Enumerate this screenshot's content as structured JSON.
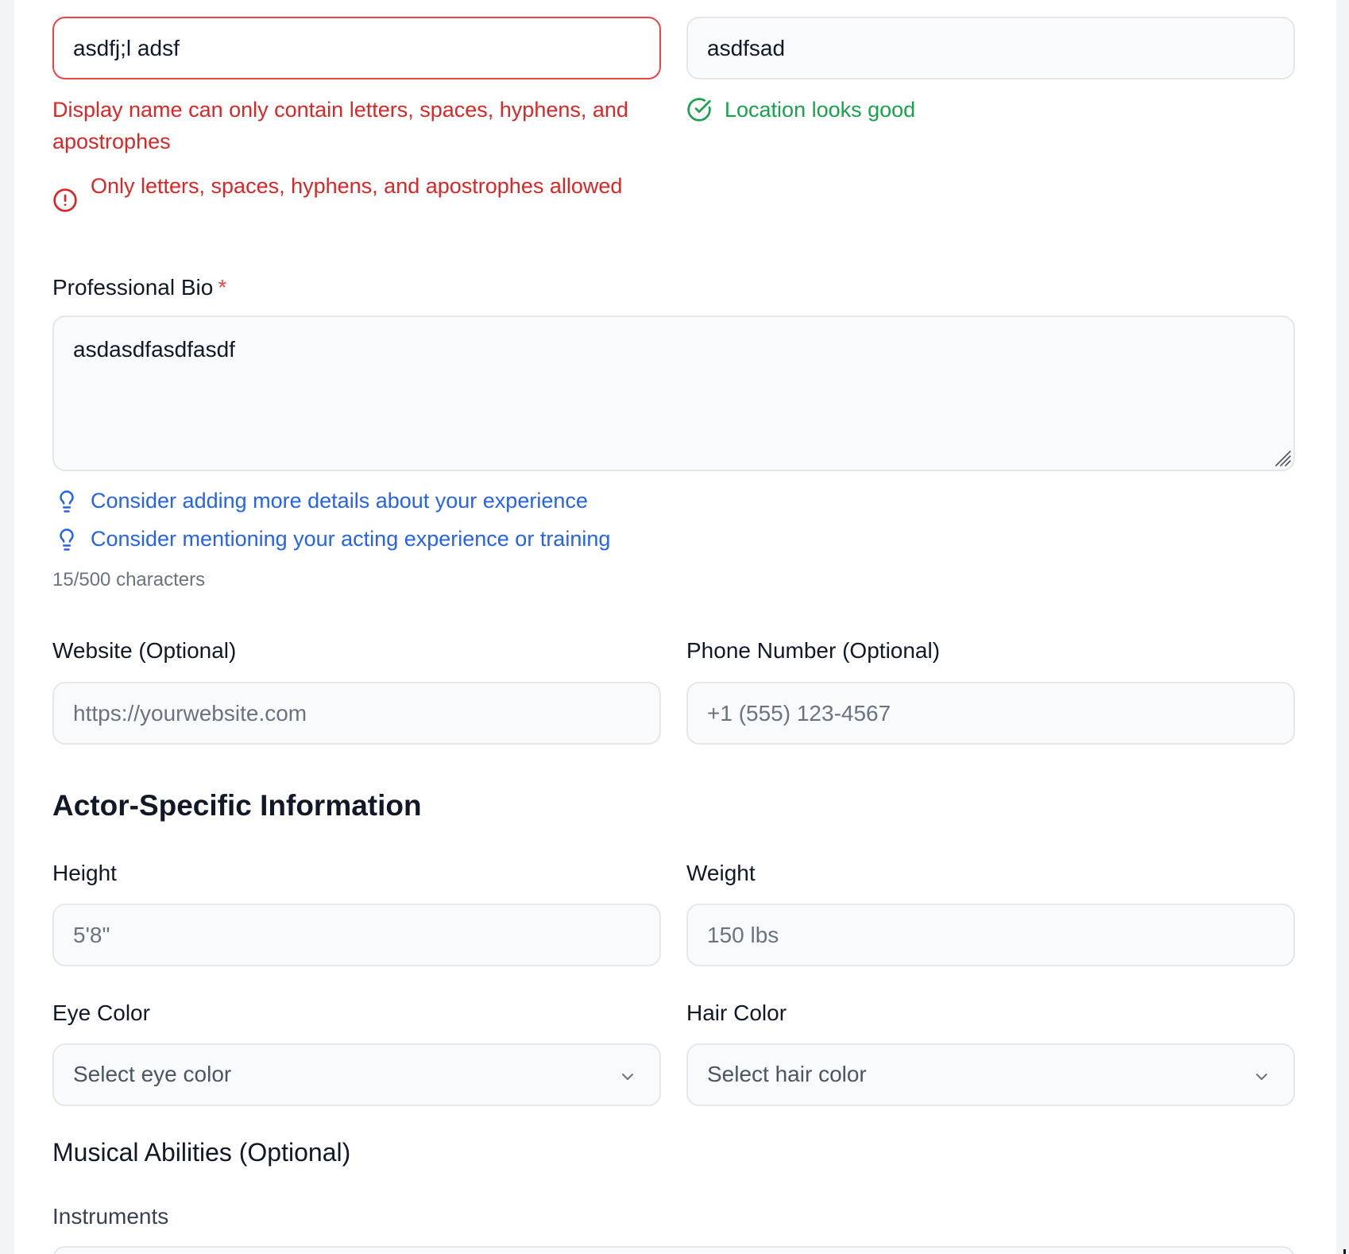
{
  "colors": {
    "error": "#dc2626",
    "success": "#16a34a",
    "hint": "#2563eb",
    "required": "#ef4444"
  },
  "display_name": {
    "value": "asdfj;l adsf",
    "error_message": "Display name can only contain letters, spaces, hyphens, and apostrophes",
    "validation_message": "Only letters, spaces, hyphens, and apostrophes allowed",
    "icon": "alert-circle-icon"
  },
  "location": {
    "value": "asdfsad",
    "success_message": "Location looks good",
    "icon": "check-circle-icon"
  },
  "bio": {
    "label": "Professional Bio",
    "required_mark": "*",
    "value": "asdasdfasdfasdf",
    "suggestions": [
      "Consider adding more details about your experience",
      "Consider mentioning your acting experience or training"
    ],
    "suggestion_icon": "lightbulb-icon",
    "counter": "15/500 characters"
  },
  "website": {
    "label": "Website (Optional)",
    "placeholder": "https://yourwebsite.com"
  },
  "phone": {
    "label": "Phone Number (Optional)",
    "placeholder": "+1 (555) 123-4567"
  },
  "actor_section": {
    "title": "Actor-Specific Information",
    "height": {
      "label": "Height",
      "placeholder": "5'8\""
    },
    "weight": {
      "label": "Weight",
      "placeholder": "150 lbs"
    },
    "eye_color": {
      "label": "Eye Color",
      "selected": "Select eye color"
    },
    "hair_color": {
      "label": "Hair Color",
      "selected": "Select hair color"
    }
  },
  "musical_section": {
    "title": "Musical Abilities (Optional)",
    "instruments_label": "Instruments"
  }
}
